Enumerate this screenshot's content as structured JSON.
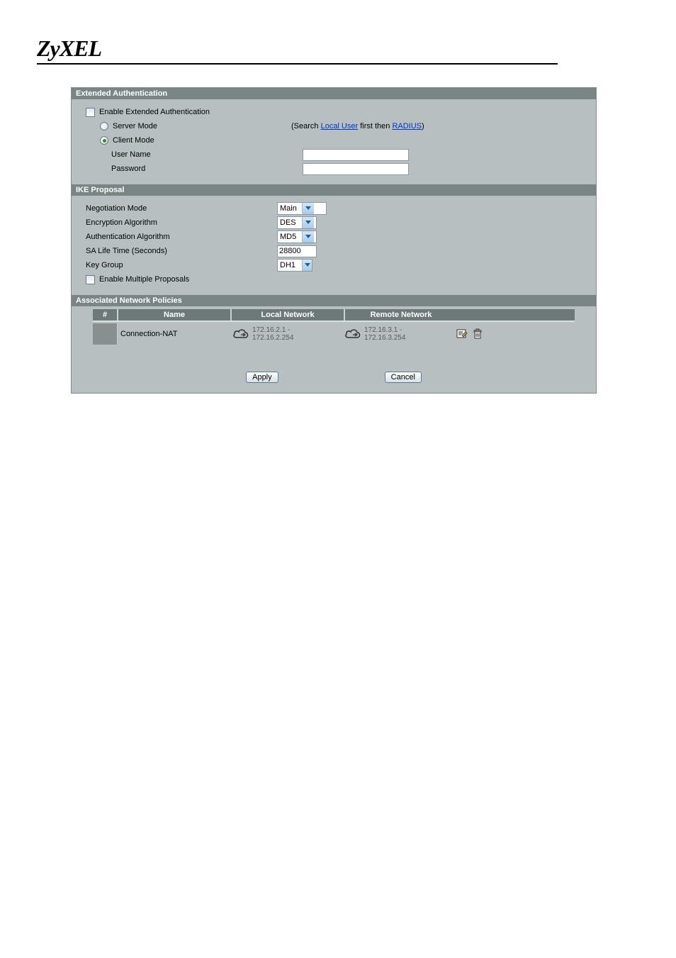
{
  "brand": "ZyXEL",
  "sections": {
    "extauth": {
      "title": "Extended Authentication",
      "enable_label": "Enable Extended Authentication",
      "server_mode_label": "Server Mode",
      "client_mode_label": "Client Mode",
      "client_mode_selected": true,
      "username_label": "User Name",
      "password_label": "Password",
      "search_prefix": "(Search ",
      "search_link1": "Local User",
      "search_mid": " first then ",
      "search_link2": "RADIUS",
      "search_suffix": ")"
    },
    "ike": {
      "title": "IKE Proposal",
      "negotiation_label": "Negotiation Mode",
      "negotiation_value": "Main",
      "encryption_label": "Encryption Algorithm",
      "encryption_value": "DES",
      "auth_label": "Authentication Algorithm",
      "auth_value": "MD5",
      "sa_life_label": "SA Life Time (Seconds)",
      "sa_life_value": "28800",
      "key_group_label": "Key Group",
      "key_group_value": "DH1",
      "multiple_label": "Enable Multiple Proposals"
    },
    "policies": {
      "title": "Associated Network Policies",
      "col_num": "#",
      "col_name": "Name",
      "col_local": "Local Network",
      "col_remote": "Remote Network",
      "rows": [
        {
          "name": "Connection-NAT",
          "local_start": "172.16.2.1 -",
          "local_end": "172.16.2.254",
          "remote_start": "172.16.3.1 -",
          "remote_end": "172.16.3.254"
        }
      ]
    }
  },
  "buttons": {
    "apply": "Apply",
    "cancel": "Cancel"
  }
}
